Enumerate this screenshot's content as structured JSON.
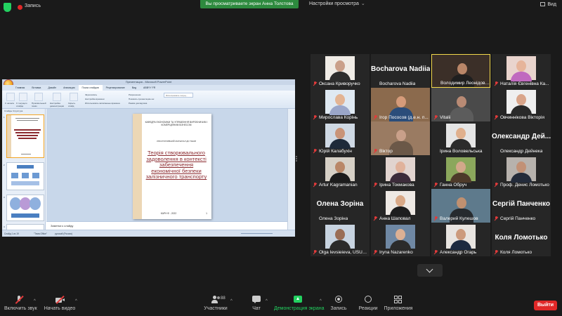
{
  "topbar": {
    "recording_label": "Запись",
    "share_banner": "Вы просматриваете экран Анна Толстова",
    "view_options": "Настройки просмотра",
    "view_button": "Вид",
    "colors": {
      "security_shield": "#23d160",
      "recording": "#e02828",
      "banner": "#2d8a3e"
    }
  },
  "shared_screen": {
    "window_title": "Презентация - Microsoft PowerPoint",
    "tabs": [
      "Главная",
      "Вставка",
      "Дизайн",
      "Анимация",
      "Показ слайдов",
      "Рецензирование",
      "Вид",
      "ABBYY FR"
    ],
    "active_tab": "Показ слайдов",
    "ribbon": {
      "start_slideshow": "С начала",
      "from_current": "С текущего слайда",
      "custom_show": "Произвольный показ",
      "setup_show": "Настройка демонстрации",
      "hide_slide": "Скрыть слайд",
      "record_narration": "Звукозапись",
      "rehearse": "Настройка времени",
      "use_timings": "Использовать записанные времена",
      "resolution": "Разрешение:",
      "show_on": "Показать презентацию на:",
      "presenter_view": "Режим докладчика",
      "monitor_value": "Использовать текущ..."
    },
    "left_tabs": "Слайды  Структура",
    "slide": {
      "organization": "КАФЕДРА ЕКОНОМІКИ ТА УПРАВЛІННЯ ВИРОБНИЧИМ І КОМЕРЦІЙНИМ БІЗНЕСОМ",
      "doc_type": "ІЛЮСТРАТИВНИЙ МАТЕРІАЛ ДО ТЕМИ",
      "title": "Теорія створювального задоволення в контексті забезпечення економічної безпеки залізничного транспорту",
      "year_line": "КАРН Ф - 2022",
      "page_number": "1"
    },
    "notes_placeholder": "Заметки к слайду",
    "status": {
      "slide_counter": "Слайд 1 из 19",
      "theme": "\"Тема Office\"",
      "language": "русский (Россия)"
    }
  },
  "participants": [
    {
      "name": "Оксана Криворучко",
      "muted": true,
      "mode": "avatar",
      "colors": {
        "bg": "#f0ece6",
        "head": "#caa08a",
        "body": "#2d2d2d"
      }
    },
    {
      "name": "Bocharova Nadiia",
      "muted": false,
      "mode": "text",
      "display": "Bocharova Nadiia"
    },
    {
      "name": "Володимир Леонідович ...",
      "muted": false,
      "mode": "wide",
      "active": true,
      "colors": {
        "bg": "#3b2f28",
        "head": "#b98668",
        "body": "#1f1f1f"
      }
    },
    {
      "name": "Наталія Євгенівна Ка...",
      "muted": true,
      "mode": "avatar",
      "colors": {
        "bg": "#e9d4cd",
        "head": "#e6b49a",
        "body": "#c06abf"
      }
    },
    {
      "name": "Мирослава Корінь",
      "muted": true,
      "mode": "avatar",
      "colors": {
        "bg": "#dfe9f2",
        "head": "#e3b493",
        "body": "#9aa6c9"
      }
    },
    {
      "name": "Ігор Пососов (д.е.н. п...",
      "muted": true,
      "mode": "wide",
      "colors": {
        "bg": "#8b6a4d",
        "head": "#d59b7a",
        "body": "#2b4d7a"
      }
    },
    {
      "name": "Vitalii",
      "muted": true,
      "mode": "wide",
      "colors": {
        "bg": "#4a4a4a",
        "head": "#b88a74",
        "body": "#5c5c5c"
      }
    },
    {
      "name": "Овчиннікова Вікторія",
      "muted": true,
      "mode": "avatar",
      "colors": {
        "bg": "#efefef",
        "head": "#d9a58a",
        "body": "#2a2a2a"
      }
    },
    {
      "name": "Юрій Калабухін",
      "muted": true,
      "mode": "avatar",
      "colors": {
        "bg": "#cfd9e4",
        "head": "#c99478",
        "body": "#1e2a3a"
      }
    },
    {
      "name": "Віктор",
      "muted": true,
      "mode": "wide",
      "colors": {
        "bg": "#9a7b62",
        "head": "#c9a08a",
        "body": "#6b5848"
      }
    },
    {
      "name": "Ірина Воловельська",
      "muted": false,
      "mode": "avatar",
      "colors": {
        "bg": "#e5e5e5",
        "head": "#e0b08d",
        "body": "#2c2c2c"
      }
    },
    {
      "name": "Олександр Дейнека",
      "muted": false,
      "mode": "text",
      "display": "Олександр Дей..."
    },
    {
      "name": "Artur Kagramanian",
      "muted": true,
      "mode": "avatar",
      "colors": {
        "bg": "#d6d0c6",
        "head": "#b98767",
        "body": "#1c1c1c"
      }
    },
    {
      "name": "Ірина Токмакова",
      "muted": true,
      "mode": "avatar",
      "colors": {
        "bg": "#e1d4cf",
        "head": "#e0b29b",
        "body": "#3c2c3a"
      }
    },
    {
      "name": "Ганна Обруч",
      "muted": true,
      "mode": "avatar",
      "colors": {
        "bg": "#8ba75c",
        "head": "#d2a88a",
        "body": "#4d3a2a"
      }
    },
    {
      "name": "Проф. Денис Ломотько",
      "muted": true,
      "mode": "avatar",
      "colors": {
        "bg": "#b7b2ad",
        "head": "#c29176",
        "body": "#232b3a"
      }
    },
    {
      "name": "Олена Зоріна",
      "muted": false,
      "mode": "text",
      "display": "Олена Зоріна"
    },
    {
      "name": "Анна Шаповал",
      "muted": true,
      "mode": "avatar",
      "colors": {
        "bg": "#eee9e4",
        "head": "#d9a987",
        "body": "#1e1e1e"
      }
    },
    {
      "name": "Валерий Кулешов",
      "muted": true,
      "mode": "wide",
      "colors": {
        "bg": "#5e7a8c",
        "head": "#c09070",
        "body": "#262a2e"
      }
    },
    {
      "name": "Сергій Панченко",
      "muted": true,
      "mode": "text",
      "display": "Сергій Панченко"
    },
    {
      "name": "Olga Ievsieieva, USURT",
      "muted": true,
      "mode": "avatar",
      "colors": {
        "bg": "#c7d3e0",
        "head": "#9a6d55",
        "body": "#2a2a2a"
      }
    },
    {
      "name": "Iryna Nazarenko",
      "muted": true,
      "mode": "avatar",
      "colors": {
        "bg": "#6f88a4",
        "head": "#dcb094",
        "body": "#2b2b2b"
      }
    },
    {
      "name": "Александр Огарь",
      "muted": true,
      "mode": "avatar",
      "colors": {
        "bg": "#e8e4e0",
        "head": "#cc9a7c",
        "body": "#1d2a40"
      }
    },
    {
      "name": "Коля Ломотько",
      "muted": true,
      "mode": "text",
      "display": "Коля Ломотько"
    }
  ],
  "toolbar": {
    "unmute": "Включить звук",
    "start_video": "Начать видео",
    "participants": "Участники",
    "participants_count": "88",
    "chat": "Чат",
    "share_screen": "Демонстрация экрана",
    "record": "Запись",
    "reactions": "Реакции",
    "apps": "Приложения",
    "leave": "Выйти"
  }
}
